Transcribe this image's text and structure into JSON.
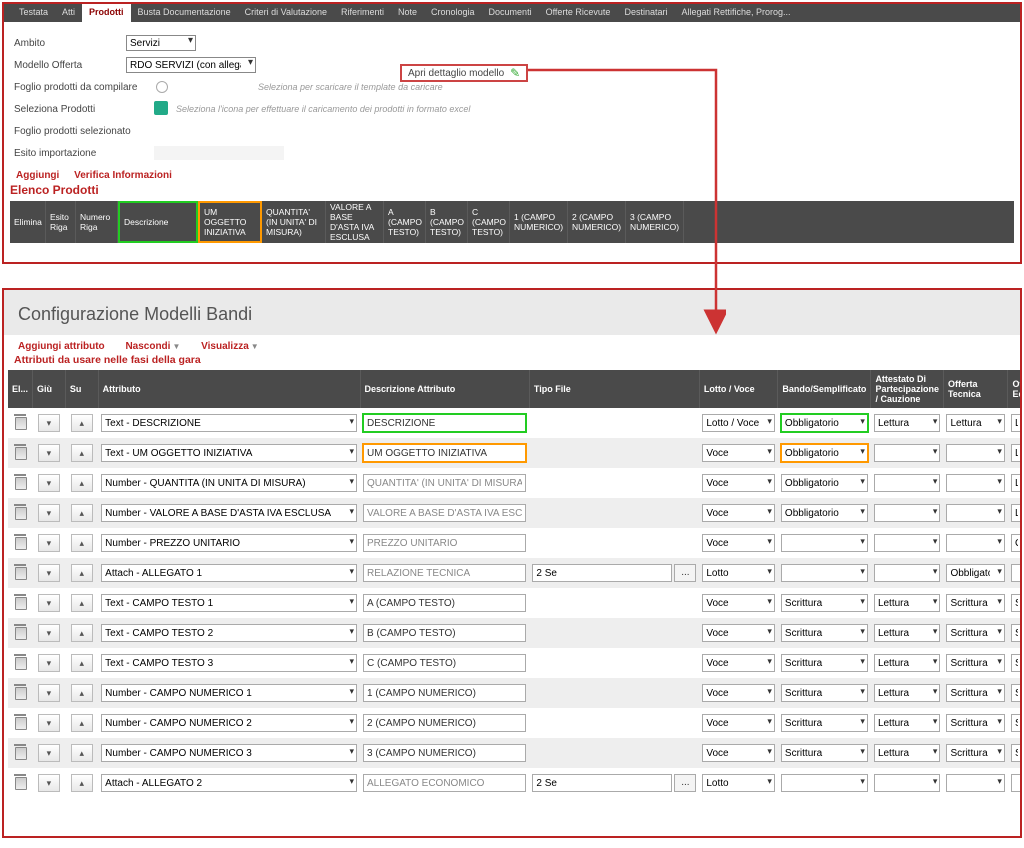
{
  "tabs": [
    "Testata",
    "Atti",
    "Prodotti",
    "Busta Documentazione",
    "Criteri di Valutazione",
    "Riferimenti",
    "Note",
    "Cronologia",
    "Documenti",
    "Offerte Ricevute",
    "Destinatari",
    "Allegati Rettifiche, Prorog..."
  ],
  "activeTabIndex": 2,
  "form": {
    "ambito": {
      "label": "Ambito",
      "value": "Servizi"
    },
    "modello": {
      "label": "Modello Offerta",
      "value": "RDO SERVIZI (con allegato tecnico)"
    },
    "detail_link": "Apri dettaglio modello",
    "foglio_comp": {
      "label": "Foglio prodotti da compilare",
      "hint": "Seleziona per scaricare il template da caricare"
    },
    "seleziona": {
      "label": "Seleziona Prodotti",
      "hint": "Seleziona l'icona per effettuare il caricamento dei prodotti in formato excel"
    },
    "foglio_sel": {
      "label": "Foglio prodotti selezionato"
    },
    "esito": {
      "label": "Esito importazione"
    }
  },
  "actions1": {
    "aggiungi": "Aggiungi",
    "verifica": "Verifica Informazioni"
  },
  "section1": "Elenco Prodotti",
  "grid1_cols": [
    "Elimina",
    "Esito Riga",
    "Numero Riga",
    "Descrizione",
    "UM OGGETTO INIZIATIVA",
    "QUANTITA' (IN UNITA' DI MISURA)",
    "VALORE A BASE D'ASTA IVA ESCLUSA",
    "A (CAMPO TESTO)",
    "B (CAMPO TESTO)",
    "C (CAMPO TESTO)",
    "1 (CAMPO NUMERICO)",
    "2 (CAMPO NUMERICO)",
    "3 (CAMPO NUMERICO)"
  ],
  "p2_title": "Configurazione Modelli Bandi",
  "p2_actions": {
    "aggiungi": "Aggiungi attributo",
    "nascondi": "Nascondi",
    "visualizza": "Visualizza"
  },
  "p2_sub": "Attributi da usare nelle fasi della gara",
  "p2_cols": {
    "el": "El...",
    "giu": "Giù",
    "su": "Su",
    "attr": "Attributo",
    "desc": "Descrizione Attributo",
    "tipo": "Tipo File",
    "lv": "Lotto / Voce",
    "bs": "Bando/Semplificato",
    "att": "Attestato Di Partecipazione / Cauzione",
    "ot": "Offerta Tecnica",
    "oe": "Off Eco"
  },
  "rows": [
    {
      "attr": "Text - DESCRIZIONE",
      "desc": "DESCRIZIONE",
      "lv": "Lotto / Voce",
      "bs": "Obbligatorio",
      "att": "Lettura",
      "ot": "Lettura",
      "oe": "Let",
      "hl": "green",
      "descHl": "green"
    },
    {
      "attr": "Text - UM OGGETTO INIZIATIVA",
      "desc": "UM OGGETTO INIZIATIVA",
      "lv": "Voce",
      "bs": "Obbligatorio",
      "att": "",
      "ot": "",
      "oe": "Let",
      "hl": "orange",
      "descHl": "orange"
    },
    {
      "attr": "Number - QUANTITA (IN UNITÀ DI MISURA)",
      "desc": "QUANTITA' (IN UNITA' DI MISURA)",
      "descRo": true,
      "lv": "Voce",
      "bs": "Obbligatorio",
      "att": "",
      "ot": "",
      "oe": "Let"
    },
    {
      "attr": "Number - VALORE A BASE D'ASTA IVA ESCLUSA",
      "desc": "VALORE A BASE D'ASTA IVA ESCLUSA",
      "descRo": true,
      "lv": "Voce",
      "bs": "Obbligatorio",
      "att": "",
      "ot": "",
      "oe": "Let"
    },
    {
      "attr": "Number - PREZZO UNITARIO",
      "desc": "PREZZO UNITARIO",
      "descRo": true,
      "lv": "Voce",
      "bs": "",
      "att": "",
      "ot": "",
      "oe": "Ob"
    },
    {
      "attr": "Attach - ALLEGATO 1",
      "desc": "RELAZIONE TECNICA",
      "descRo": true,
      "tipo": "2 Se",
      "lv": "Lotto",
      "bs": "",
      "att": "",
      "ot": "Obbligatorio",
      "oe": ""
    },
    {
      "attr": "Text - CAMPO TESTO 1",
      "desc": "A (CAMPO TESTO)",
      "lv": "Voce",
      "bs": "Scrittura",
      "att": "Lettura",
      "ot": "Scrittura",
      "oe": "Scr"
    },
    {
      "attr": "Text - CAMPO TESTO 2",
      "desc": "B (CAMPO TESTO)",
      "lv": "Voce",
      "bs": "Scrittura",
      "att": "Lettura",
      "ot": "Scrittura",
      "oe": "Scr"
    },
    {
      "attr": "Text - CAMPO TESTO 3",
      "desc": "C (CAMPO TESTO)",
      "lv": "Voce",
      "bs": "Scrittura",
      "att": "Lettura",
      "ot": "Scrittura",
      "oe": "Scr"
    },
    {
      "attr": "Number - CAMPO NUMERICO 1",
      "desc": "1 (CAMPO NUMERICO)",
      "lv": "Voce",
      "bs": "Scrittura",
      "att": "Lettura",
      "ot": "Scrittura",
      "oe": "Scr"
    },
    {
      "attr": "Number - CAMPO NUMERICO 2",
      "desc": "2 (CAMPO NUMERICO)",
      "lv": "Voce",
      "bs": "Scrittura",
      "att": "Lettura",
      "ot": "Scrittura",
      "oe": "Scr"
    },
    {
      "attr": "Number - CAMPO NUMERICO 3",
      "desc": "3 (CAMPO NUMERICO)",
      "lv": "Voce",
      "bs": "Scrittura",
      "att": "Lettura",
      "ot": "Scrittura",
      "oe": "Scr"
    },
    {
      "attr": "Attach - ALLEGATO 2",
      "desc": "ALLEGATO ECONOMICO",
      "descRo": true,
      "tipo": "2 Se",
      "lv": "Lotto",
      "bs": "",
      "att": "",
      "ot": "",
      "oe": ""
    }
  ]
}
